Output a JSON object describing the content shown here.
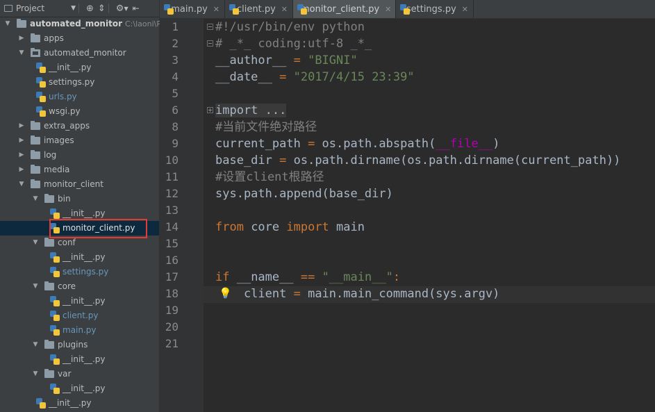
{
  "project_panel": {
    "title": "Project",
    "tree": [
      {
        "label": "automated_monitor",
        "path_hint": "C:\\laoni\\P",
        "kind": "root",
        "expanded": true
      },
      {
        "label": "apps",
        "kind": "folder",
        "expanded": false
      },
      {
        "label": "automated_monitor",
        "kind": "folder",
        "expanded": true
      },
      {
        "label": "__init__.py",
        "kind": "file"
      },
      {
        "label": "settings.py",
        "kind": "file"
      },
      {
        "label": "urls.py",
        "kind": "file",
        "accent": true
      },
      {
        "label": "wsgi.py",
        "kind": "file"
      },
      {
        "label": "extra_apps",
        "kind": "folder",
        "expanded": false
      },
      {
        "label": "images",
        "kind": "folder",
        "expanded": false
      },
      {
        "label": "log",
        "kind": "folder",
        "expanded": false
      },
      {
        "label": "media",
        "kind": "folder",
        "expanded": false
      },
      {
        "label": "monitor_client",
        "kind": "folder",
        "expanded": true
      },
      {
        "label": "bin",
        "kind": "folder",
        "expanded": true
      },
      {
        "label": "__init__.py",
        "kind": "file"
      },
      {
        "label": "monitor_client.py",
        "kind": "file",
        "selected": true
      },
      {
        "label": "conf",
        "kind": "folder",
        "expanded": true
      },
      {
        "label": "__init__.py",
        "kind": "file"
      },
      {
        "label": "settings.py",
        "kind": "file",
        "accent": true
      },
      {
        "label": "core",
        "kind": "folder",
        "expanded": true
      },
      {
        "label": "__init__.py",
        "kind": "file"
      },
      {
        "label": "client.py",
        "kind": "file",
        "accent": true
      },
      {
        "label": "main.py",
        "kind": "file",
        "accent": true
      },
      {
        "label": "plugins",
        "kind": "folder",
        "expanded": true
      },
      {
        "label": "__init__.py",
        "kind": "file"
      },
      {
        "label": "var",
        "kind": "folder",
        "expanded": true
      },
      {
        "label": "__init__.py",
        "kind": "file"
      },
      {
        "label": "__init__.py",
        "kind": "file"
      }
    ]
  },
  "tabs": [
    {
      "label": "main.py",
      "active": false
    },
    {
      "label": "client.py",
      "active": false
    },
    {
      "label": "monitor_client.py",
      "active": true
    },
    {
      "label": "settings.py",
      "active": false
    }
  ],
  "editor": {
    "line_numbers": [
      "1",
      "2",
      "3",
      "4",
      "5",
      "6",
      "8",
      "9",
      "10",
      "11",
      "12",
      "13",
      "14",
      "15",
      "16",
      "17",
      "18",
      "19",
      "20",
      "21"
    ],
    "lines": {
      "l1": "#!/usr/bin/env python",
      "l2": "# _*_ coding:utf-8 _*_",
      "l3_name": "__author__",
      "l3_eq": " = ",
      "l3_val": "\"BIGNI\"",
      "l4_name": "__date__",
      "l4_eq": " = ",
      "l4_val": "\"2017/4/15 23:39\"",
      "l6_fold": "import ...",
      "l8": "#当前文件绝对路径",
      "l9_a": "current_path",
      "l9_eq": " = ",
      "l9_b": "os.path.abspath(",
      "l9_c": "__file__",
      "l9_d": ")",
      "l10_a": "base_dir",
      "l10_eq": " = ",
      "l10_b": "os.path.dirname(os.path.dirname(current_path))",
      "l11": "#设置client根路径",
      "l12": "sys.path.append(base_dir)",
      "l14_kw1": "from",
      "l14_mid": " core ",
      "l14_kw2": "import",
      "l14_end": " main",
      "l17_kw": "if",
      "l17_name": " __name__ ",
      "l17_op": "==",
      "l17_str": " \"__main__\"",
      "l17_colon": ":",
      "l18_a": "    client",
      "l18_eq": " = ",
      "l18_b": "main.main_command(sys.argv)"
    }
  },
  "colors": {
    "keyword": "#cc7832",
    "string": "#6a8759",
    "comment": "#808080",
    "dunder": "#b200b2",
    "highlight_box": "#e53935"
  }
}
